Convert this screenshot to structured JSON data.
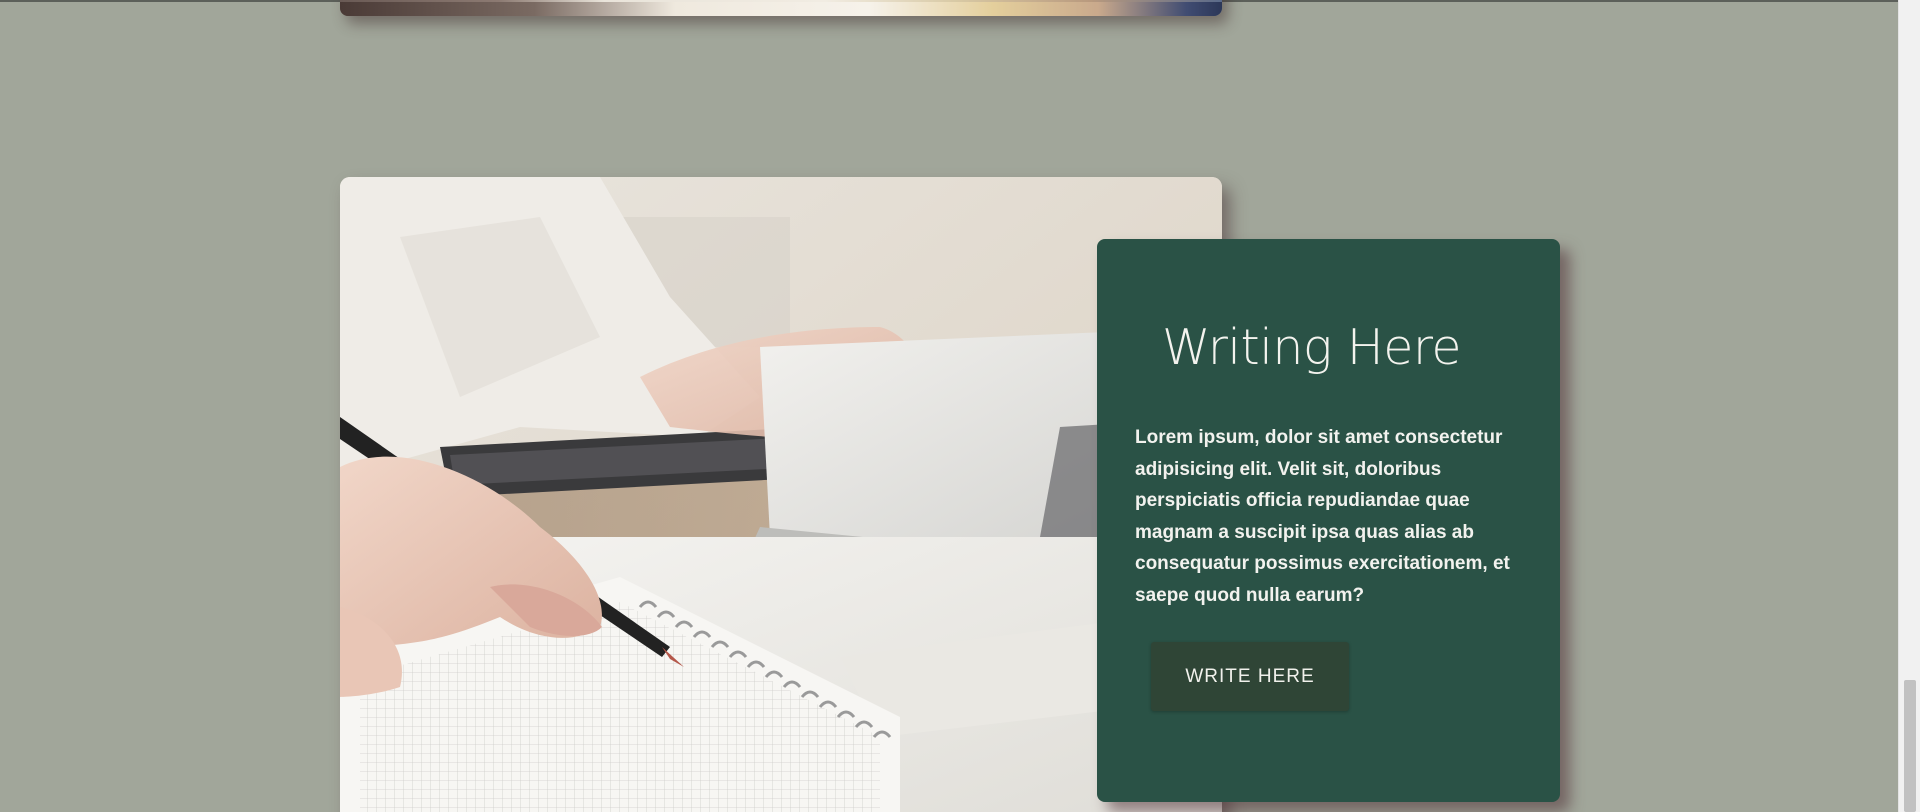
{
  "section": {
    "title": "Writing Here",
    "body": "Lorem ipsum, dolor sit amet consectetur adipisicing elit. Velit sit, doloribus perspiciatis officia repudiandae quae magnam a suscipit ipsa quas alias ab consequatur possimus exercitationem, et saepe quod nulla earum?",
    "button_label": "WRITE HERE"
  },
  "colors": {
    "page_background": "#a1a69a",
    "card_background": "#2a5246",
    "button_background": "#2f4536",
    "text_light": "#f2f2ee"
  },
  "icons": {
    "main_image": "writing-notebook-laptop-photo",
    "previous_image": "previous-section-photo"
  }
}
